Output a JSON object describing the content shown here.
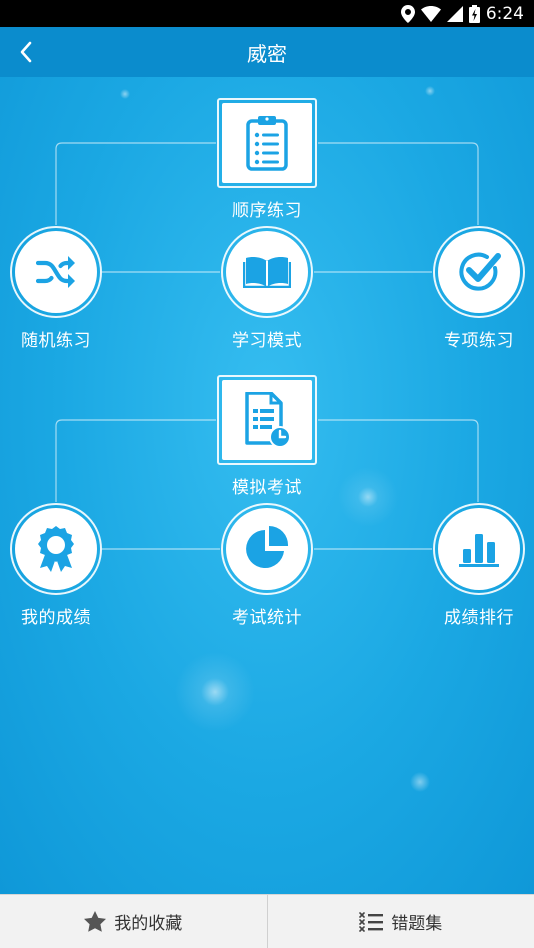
{
  "status_bar": {
    "time": "6:24",
    "icons": [
      "location-icon",
      "wifi-icon",
      "signal-icon",
      "battery-icon"
    ]
  },
  "app_bar": {
    "title": "威密",
    "back_icon": "chevron-left-icon"
  },
  "colors": {
    "accent": "#0b8ccd",
    "icon_blue": "#1ba3e4",
    "background": "#1aa7e0"
  },
  "menu": {
    "sequential": {
      "label": "顺序练习",
      "icon": "clipboard-list-icon"
    },
    "random": {
      "label": "随机练习",
      "icon": "shuffle-icon"
    },
    "study": {
      "label": "学习模式",
      "icon": "open-book-icon"
    },
    "topic": {
      "label": "专项练习",
      "icon": "check-circle-icon"
    },
    "mock": {
      "label": "模拟考试",
      "icon": "exam-paper-clock-icon"
    },
    "my_scores": {
      "label": "我的成绩",
      "icon": "award-ribbon-icon"
    },
    "exam_stats": {
      "label": "考试统计",
      "icon": "pie-chart-icon"
    },
    "ranking": {
      "label": "成绩排行",
      "icon": "bar-chart-icon"
    }
  },
  "bottom_bar": {
    "favorites": {
      "label": "我的收藏",
      "icon": "star-icon"
    },
    "wrong_questions": {
      "label": "错题集",
      "icon": "list-x-icon"
    }
  }
}
